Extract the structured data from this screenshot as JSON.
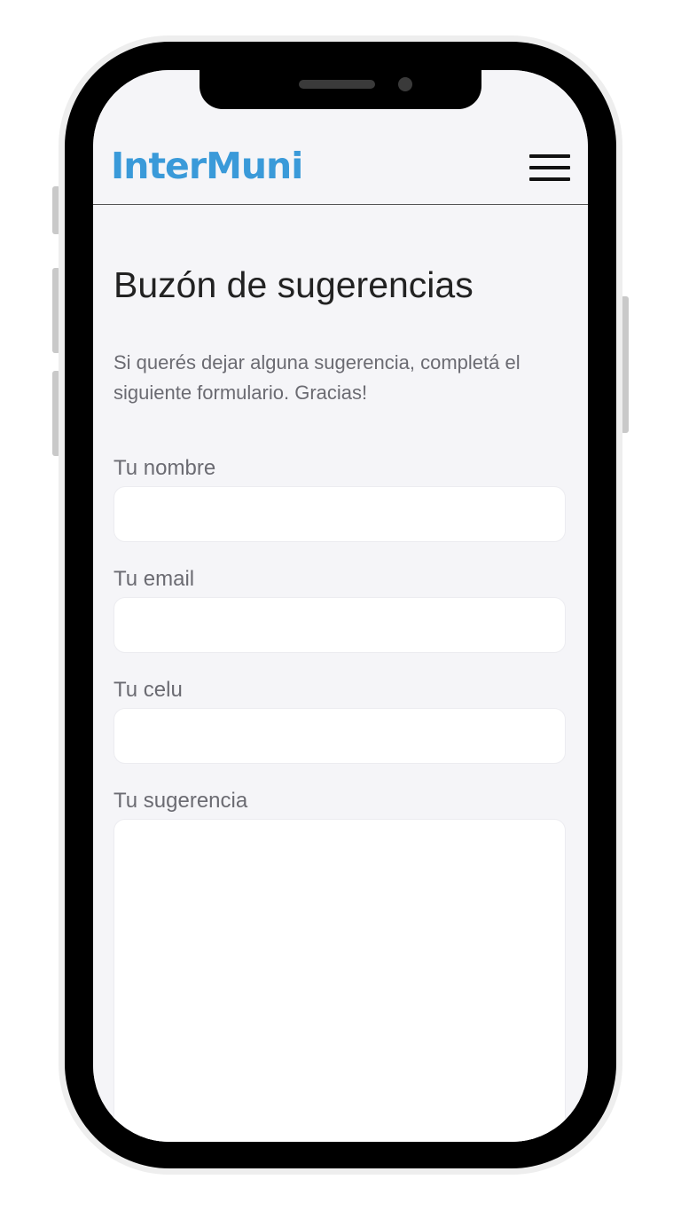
{
  "header": {
    "brand": "InterMuni",
    "menu_icon": "hamburger-menu-icon"
  },
  "page": {
    "title": "Buzón de sugerencias",
    "intro": "Si querés dejar alguna sugerencia, completá el siguiente formulario. Gracias!"
  },
  "form": {
    "name": {
      "label": "Tu nombre",
      "value": "",
      "placeholder": ""
    },
    "email": {
      "label": "Tu email",
      "value": "",
      "placeholder": ""
    },
    "phone": {
      "label": "Tu celu",
      "value": "",
      "placeholder": ""
    },
    "suggestion": {
      "label": "Tu sugerencia",
      "value": "",
      "placeholder": ""
    }
  },
  "colors": {
    "brand": "#3a9ad9",
    "page_background": "#f5f5f8",
    "input_background": "#ffffff",
    "text_muted": "#6b6b72",
    "text_dark": "#222222"
  }
}
